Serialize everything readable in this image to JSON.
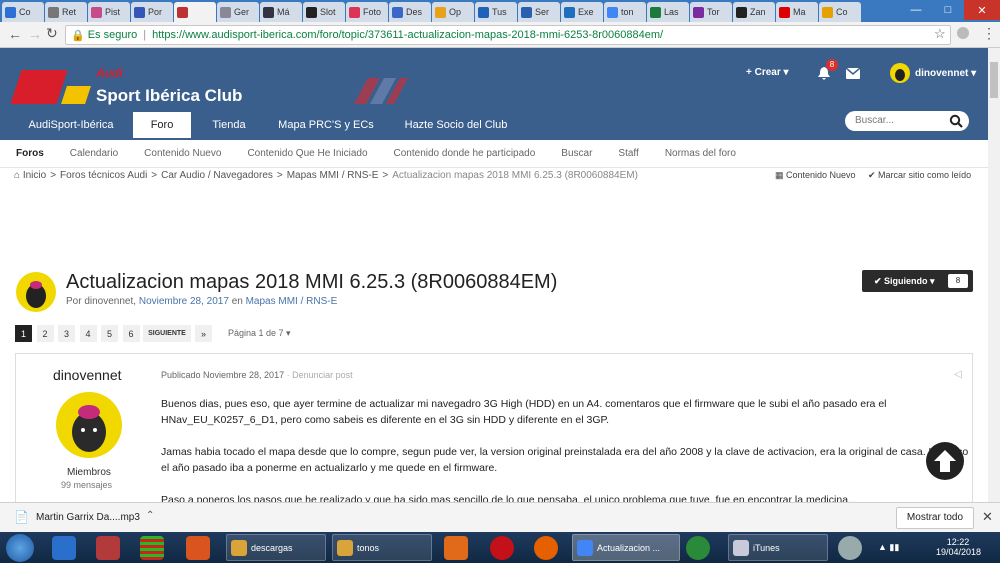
{
  "browser": {
    "tabs": [
      "Co",
      "Ret",
      "Pist",
      "Por",
      "",
      "Ger",
      "Má",
      "Slot",
      "Foto",
      "Des",
      "Op",
      "Tus",
      "Ser",
      "Exe",
      "ton",
      "Las",
      "Tor",
      "Zan",
      "Ma",
      "Co"
    ],
    "url_secure_label": "Es seguro",
    "url": "https://www.audisport-iberica.com/foro/topic/373611-actualizacion-mapas-2018-mmi-6253-8r0060884em/"
  },
  "site": {
    "logo_top": "Audi",
    "logo_main": "Sport Ibérica Club",
    "create_label": "+ Crear",
    "notif_count": "8",
    "username": "dinovennet",
    "nav_tabs": [
      "AudiSport-Ibérica",
      "Foro",
      "Tienda",
      "Mapa PRC'S y ECs",
      "Hazte Socio del Club"
    ],
    "search_placeholder": "Buscar...",
    "subnav": [
      "Foros",
      "Calendario",
      "Contenido Nuevo",
      "Contenido Que He Iniciado",
      "Contenido donde he participado",
      "Buscar",
      "Staff",
      "Normas del foro"
    ]
  },
  "breadcrumb": {
    "items": [
      "Inicio",
      "Foros técnicos Audi",
      "Car Audio / Navegadores",
      "Mapas MMI / RNS-E",
      "Actualizacion mapas 2018 MMI 6.25.3 (8R0060884EM)"
    ],
    "sep": ">",
    "new_content": "Contenido Nuevo",
    "mark_read": "Marcar sitio como leído"
  },
  "topic": {
    "title": "Actualizacion mapas 2018 MMI 6.25.3 (8R0060884EM)",
    "by": "Por dinovennet,",
    "date": "Noviembre 28, 2017",
    "in": "en",
    "forum": "Mapas MMI / RNS-E",
    "follow_label": "Siguiendo",
    "follow_count": "8"
  },
  "pagination": {
    "pages": [
      "1",
      "2",
      "3",
      "4",
      "5",
      "6"
    ],
    "next_label": "SIGUIENTE",
    "last_label": "»",
    "page_info": "Página 1 de 7"
  },
  "post": {
    "author": "dinovennet",
    "group": "Miembros",
    "posts_count": "99 mensajes",
    "published": "Publicado Noviembre 28, 2017",
    "report": "· Denunciar post",
    "lines": [
      "Buenos dias, pues eso, que ayer termine de actualizar mi navegadro 3G High (HDD) en un A4. comentaros que el firmware que le subi el año pasado era el",
      "HNav_EU_K0257_6_D1, pero como sabeis es diferente en el 3G sin HDD y diferente en el 3GP.",
      "Jamas habia tocado el mapa desde que lo compre, segun pude ver, la version original preinstalada era del año 2008 y la clave de activacion, era la original de casa. Lo unico",
      "el año pasado iba a ponerme en actualizarlo y me quede en el firmware.",
      "Paso a poneros los pasos que he realizado y que ha sido mas sencillo de lo que pensaba, el unico problema que tuve, fue en encontrar la medicina..."
    ]
  },
  "download": {
    "file": "Martin Garrix  Da....mp3",
    "show_all": "Mostrar todo"
  },
  "taskbar": {
    "items": [
      "descargas",
      "tonos",
      "Actualizacion ...",
      "iTunes"
    ],
    "time": "12:22",
    "date": "19/04/2018"
  },
  "colors": {
    "header": "#3b5f8d",
    "accent": "#3a78c0",
    "dark": "#222222"
  }
}
